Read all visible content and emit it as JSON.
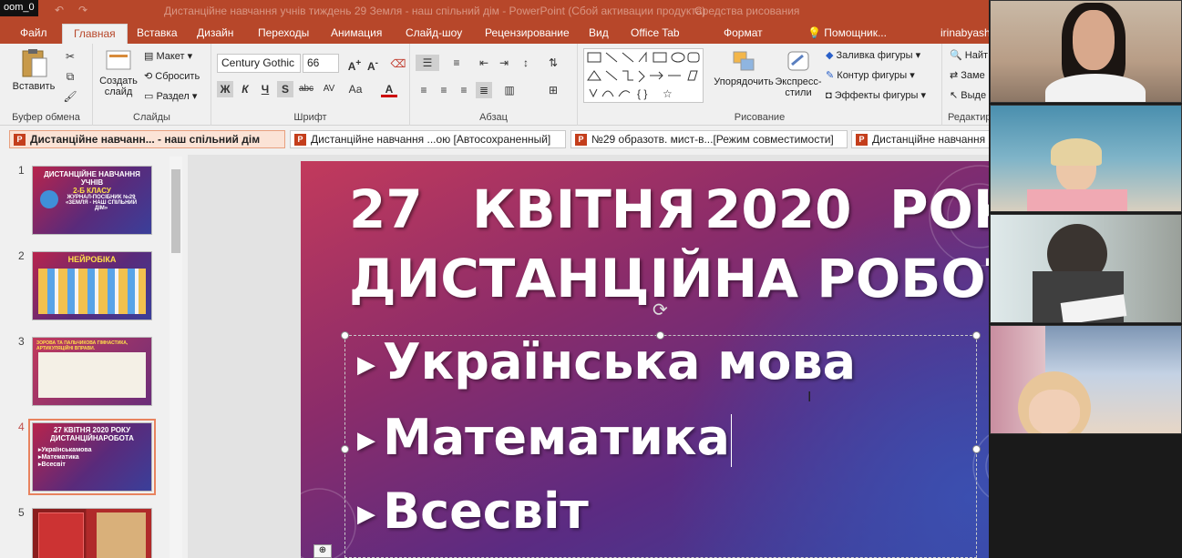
{
  "zoom_label": "oom_0",
  "window": {
    "title": "Дистанційне навчання учнів тиждень 29 Земля - наш спільний дім - PowerPoint (Сбой активации продукта)",
    "context_tab": "Средства рисования"
  },
  "tabs": [
    {
      "label": "Файл"
    },
    {
      "label": "Главная"
    },
    {
      "label": "Вставка"
    },
    {
      "label": "Дизайн"
    },
    {
      "label": "Переходы"
    },
    {
      "label": "Анимация"
    },
    {
      "label": "Слайд-шоу"
    },
    {
      "label": "Рецензирование"
    },
    {
      "label": "Вид"
    },
    {
      "label": "Office Tab"
    },
    {
      "label": "Формат"
    },
    {
      "label": "Помощник..."
    },
    {
      "label": "irinabyashl"
    }
  ],
  "ribbon": {
    "clipboard": {
      "group": "Буфер обмена",
      "paste": "Вставить"
    },
    "slides": {
      "group": "Слайды",
      "create": "Создать",
      "create2": "слайд",
      "layout": "Макет",
      "reset": "Сбросить",
      "section": "Раздел"
    },
    "font": {
      "group": "Шрифт",
      "family": "Century Gothic",
      "size": "66",
      "bold": "Ж",
      "italic": "К",
      "underline": "Ч",
      "shadow": "S",
      "strike": "abc",
      "spacing": "AV",
      "case": "Аа",
      "color": "A"
    },
    "paragraph": {
      "group": "Абзац"
    },
    "drawing": {
      "group": "Рисование",
      "arrange": "Упорядочить",
      "quick1": "Экспресс-",
      "quick2": "стили",
      "fill": "Заливка фигуры",
      "outline": "Контур фигуры",
      "effects": "Эффекты фигуры"
    },
    "editing": {
      "group": "Редактир",
      "find": "Найт",
      "replace": "Заме",
      "select": "Выде"
    }
  },
  "doc_tabs": [
    {
      "label": "Дистанційне навчанн... - наш спільний дім"
    },
    {
      "label": "Дистанційне навчання ...ою [Автосохраненный]"
    },
    {
      "label": "№29 образотв. мист-в...[Режим совместимости]"
    },
    {
      "label": "Дистанційне навчання"
    }
  ],
  "thumbnails": [
    {
      "num": "1",
      "title": "ДИСТАНЦІЙНЕ НАВЧАННЯ УЧНІВ",
      "sub": "2-Б КЛАСУ",
      "sub2": "ЖУРНАЛ-ПОСІБНИК №29 «ЗЕМЛЯ - НАШ СПІЛЬНИЙ ДІМ»"
    },
    {
      "num": "2",
      "title": "НЕЙРОБІКА"
    },
    {
      "num": "3",
      "title": "ЗОРОВА ТА ПАЛЬЧИКОВА ГІМНАСТИКА, АРТИКУЛЯЦІЙНІ ВПРАВИ."
    },
    {
      "num": "4",
      "title": "27 КВІТНЯ 2020 РОКУ ДИСТАНЦІЙНАРОБОТА",
      "items": [
        "▸Українськамова",
        "▸Математика",
        "▸Всесвіт"
      ]
    },
    {
      "num": "5"
    }
  ],
  "slide": {
    "line1": [
      "27",
      "КВІТНЯ",
      "2020",
      "РОК"
    ],
    "line2": "ДИСТАНЦІЙНА РОБОТА",
    "bullets": [
      "Українська мова",
      "Математика",
      "Всесвіт"
    ]
  },
  "colors": {
    "accent": "#b7472a",
    "tab_active_text": "#b7472a",
    "thumb_selected": "#e8835f"
  }
}
